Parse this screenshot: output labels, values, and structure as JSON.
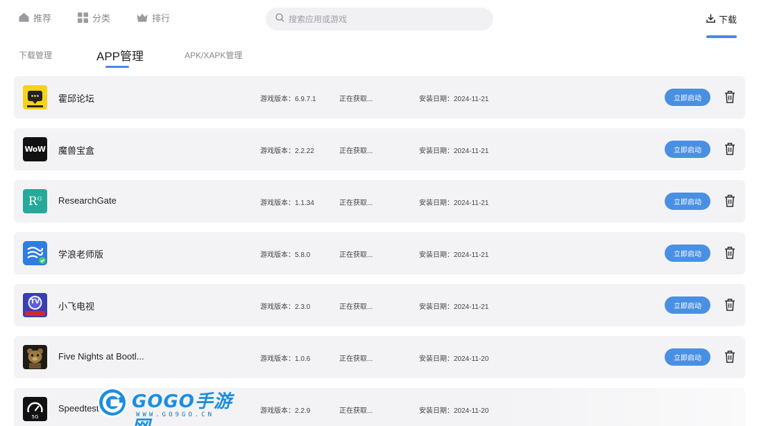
{
  "nav": {
    "recommend": "推荐",
    "category": "分类",
    "ranking": "排行",
    "download": "下载"
  },
  "search": {
    "placeholder": "搜索应用或游戏"
  },
  "subtabs": {
    "download_mgmt": "下载管理",
    "app_mgmt": "APP管理",
    "apk_mgmt": "APK/XAPK管理"
  },
  "apps": [
    {
      "name": "霍邱论坛",
      "version": "游戏版本：6.9.7.1",
      "size": "正在获取...",
      "date": "安装日期：2024-11-21",
      "action": "立即启动",
      "icon": "chat-bubble-icon"
    },
    {
      "name": "魔兽宝盒",
      "version": "游戏版本：2.2.22",
      "size": "正在获取...",
      "date": "安装日期：2024-11-21",
      "action": "立即启动",
      "icon": "wow-icon"
    },
    {
      "name": "ResearchGate",
      "version": "游戏版本：1.1.34",
      "size": "正在获取...",
      "date": "安装日期：2024-11-21",
      "action": "立即启动",
      "icon": "researchgate-icon"
    },
    {
      "name": "学浪老师版",
      "version": "游戏版本：5.8.0",
      "size": "正在获取...",
      "date": "安装日期：2024-11-21",
      "action": "立即启动",
      "icon": "xuelang-icon"
    },
    {
      "name": "小飞电视",
      "version": "游戏版本：2.3.0",
      "size": "正在获取...",
      "date": "安装日期：2024-11-21",
      "action": "立即启动",
      "icon": "tv-icon"
    },
    {
      "name": "Five Nights at Bootl...",
      "version": "游戏版本：1.0.6",
      "size": "正在获取...",
      "date": "安装日期：2024-11-20",
      "action": "立即启动",
      "icon": "bear-icon"
    },
    {
      "name": "Speedtest",
      "version": "游戏版本：2.2.9",
      "size": "正在获取...",
      "date": "安装日期：2024-11-20",
      "action": "",
      "icon": "speedometer-icon"
    }
  ],
  "icon_text": {
    "researchgate": "R",
    "researchgate_sup": "G",
    "wow": "WoW",
    "tv": "TV",
    "speedtest_badge": "5G"
  },
  "watermark": {
    "brand": "GOGO手游网",
    "url": "WWW.GO9GO.CN"
  },
  "colors": {
    "accent": "#4a86e8",
    "button": "#4a90e2",
    "row_bg": "#f3f3f5"
  }
}
